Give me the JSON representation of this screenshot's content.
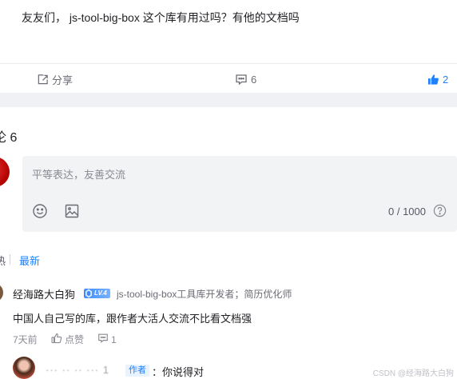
{
  "post": {
    "text": "友友们， js-tool-big-box 这个库有用过吗？有他的文档吗"
  },
  "actions": {
    "share_label": "分享",
    "comment_count": "6",
    "like_count": "2"
  },
  "comments_heading": "论 6",
  "composer": {
    "placeholder": "平等表达，友善交流",
    "counter": "0 / 1000"
  },
  "sort": {
    "hot_label": "热",
    "new_label": "最新"
  },
  "comments": [
    {
      "author": "经海路大白狗",
      "level": "LV.4",
      "title": "js-tool-big-box工具库开发者；简历优化师",
      "body": "中国人自己写的库，跟作者大活人交流不比看文档强",
      "time": "7天前",
      "like_label": "点赞",
      "reply_count": "1"
    }
  ],
  "reply": {
    "user": "··· ·· ·· ··· 1",
    "badge": "作者",
    "text": "：你说得对"
  },
  "watermark": "CSDN @经海路大白狗",
  "colors": {
    "accent": "#1e80ff",
    "band": "#f0f1f4",
    "composer_bg": "#f2f3f5"
  }
}
